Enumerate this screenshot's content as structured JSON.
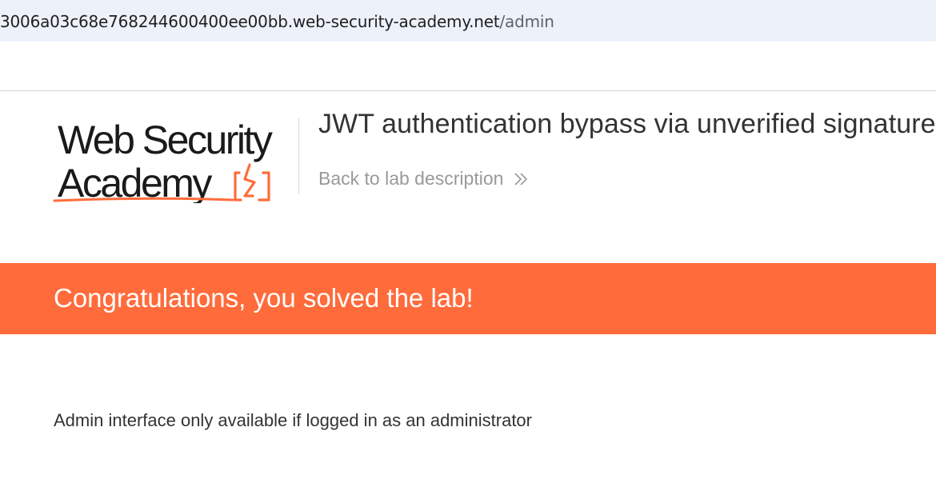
{
  "address_bar": {
    "host": "3006a03c68e768244600400ee00bb.web-security-academy.net",
    "path": "/admin"
  },
  "header": {
    "logo_line1": "Web Security",
    "logo_line2": "Academy",
    "lab_title": "JWT authentication bypass via unverified signature",
    "back_link": "Back to lab description",
    "brand_color": "#ff6b3b"
  },
  "banner": {
    "message": "Congratulations, you solved the lab!",
    "color": "#ff6b3b"
  },
  "main": {
    "admin_message": "Admin interface only available if logged in as an administrator"
  }
}
